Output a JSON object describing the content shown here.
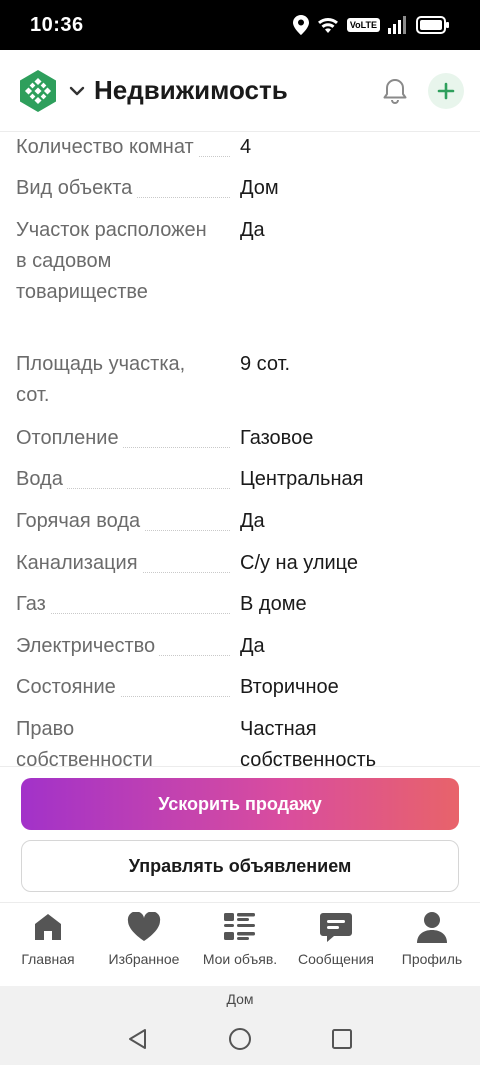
{
  "status_bar": {
    "time": "10:36",
    "volte": "VoLTE",
    "icons": [
      "location-icon",
      "wifi-icon",
      "volte-badge",
      "signal-icon",
      "battery-icon"
    ]
  },
  "header": {
    "title": "Недвижимость",
    "logo": "app-logo-icon",
    "icons": [
      "chevron-down-icon",
      "bell-icon",
      "plus-icon"
    ],
    "accent_color": "#2e9f5c"
  },
  "properties": [
    {
      "label": "Количество комнат",
      "value": "4"
    },
    {
      "label": "Вид объекта",
      "value": "Дом"
    },
    {
      "label": "Участок расположен в садовом товариществе",
      "value": "Да"
    },
    {
      "label": "Площадь участка, сот.",
      "value": "9 сот."
    },
    {
      "label": "Отопление",
      "value": "Газовое"
    },
    {
      "label": "Вода",
      "value": "Центральная"
    },
    {
      "label": "Горячая вода",
      "value": "Да"
    },
    {
      "label": "Канализация",
      "value": "С/у на улице"
    },
    {
      "label": "Газ",
      "value": "В доме"
    },
    {
      "label": "Электричество",
      "value": "Да"
    },
    {
      "label": "Состояние",
      "value": "Вторичное"
    },
    {
      "label": "Право собственности",
      "value": "Частная собственность"
    }
  ],
  "actions": {
    "promote_label": "Ускорить продажу",
    "manage_label": "Управлять объявлением",
    "promote_gradient": [
      "#a232c9",
      "#e8636a"
    ]
  },
  "bottom_nav": [
    {
      "label": "Главная",
      "icon": "home-icon"
    },
    {
      "label": "Избранное",
      "icon": "heart-icon"
    },
    {
      "label": "Мои объяв.",
      "icon": "list-icon"
    },
    {
      "label": "Сообщения",
      "icon": "chat-icon"
    },
    {
      "label": "Профиль",
      "icon": "profile-icon"
    }
  ],
  "system": {
    "caption": "Дом",
    "buttons": [
      "back-icon",
      "home-circle-icon",
      "recents-icon"
    ]
  }
}
